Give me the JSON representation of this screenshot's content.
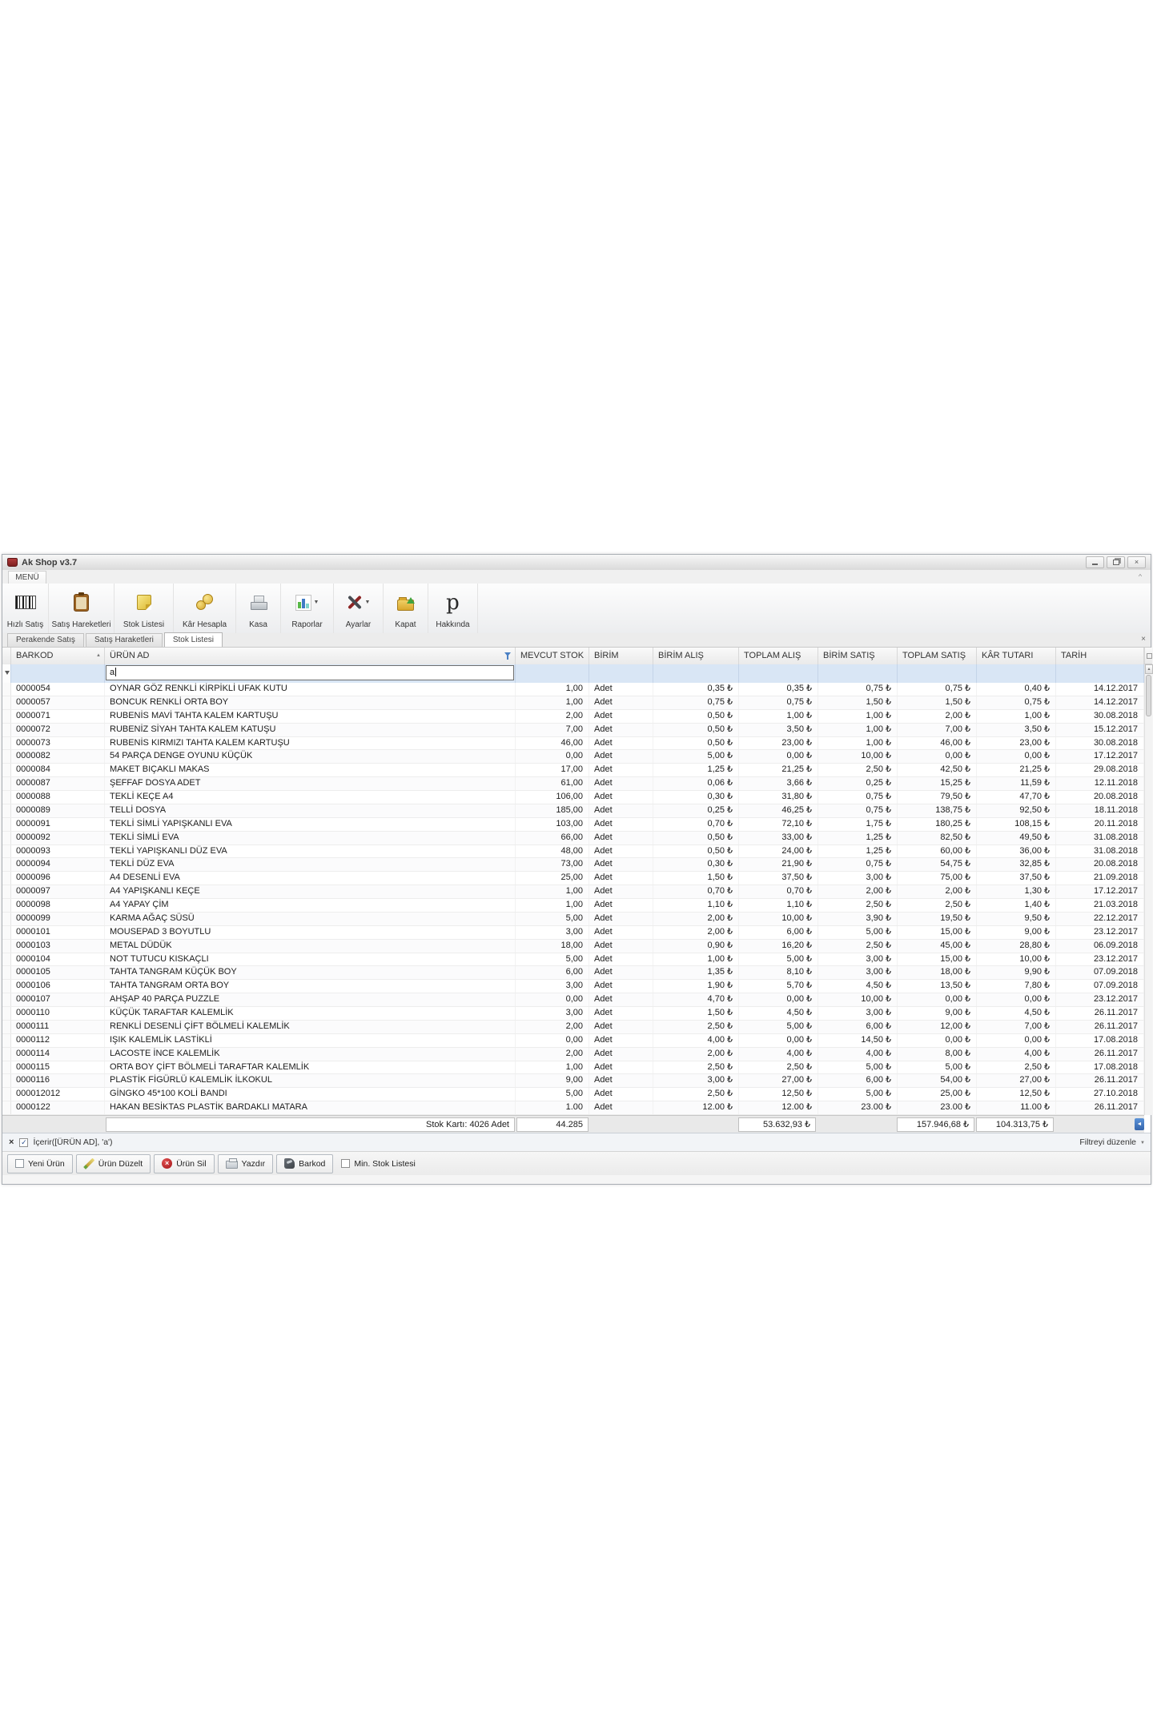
{
  "window": {
    "title": "Ak Shop v3.7"
  },
  "icons": {
    "minimize": "–",
    "restore": "❐",
    "close": "×",
    "ribbon_collapse": "^",
    "tab_close": "×",
    "sort_ascending": "▲",
    "filter_funnel": "funnel",
    "scroll_up": "▲",
    "scroll_left": "◄",
    "dropdown_arrow": "▼",
    "filter_check": "✓",
    "remove_filter": "×",
    "hakkinda_glyph": "p"
  },
  "menu": {
    "tab": "MENÜ"
  },
  "toolbar": {
    "buttons": [
      {
        "label": "Hızlı Satış",
        "icon": "barcode-icon",
        "dropdown": false
      },
      {
        "label": "Satış Hareketleri",
        "icon": "clipboard-icon",
        "dropdown": false
      },
      {
        "label": "Stok Listesi",
        "icon": "note-icon",
        "dropdown": false
      },
      {
        "label": "Kâr Hesapla",
        "icon": "coins-icon",
        "dropdown": false
      },
      {
        "label": "Kasa",
        "icon": "cash-register-icon",
        "dropdown": false
      },
      {
        "label": "Raporlar",
        "icon": "chart-icon",
        "dropdown": true
      },
      {
        "label": "Ayarlar",
        "icon": "tools-icon",
        "dropdown": true
      },
      {
        "label": "Kapat",
        "icon": "folder-up-icon",
        "dropdown": false
      },
      {
        "label": "Hakkında",
        "icon": "p-letter-icon",
        "dropdown": false
      }
    ]
  },
  "tabs": [
    {
      "label": "Perakende Satış",
      "active": false
    },
    {
      "label": "Satış Haraketleri",
      "active": false
    },
    {
      "label": "Stok Listesi",
      "active": true
    }
  ],
  "grid": {
    "columns": [
      "BARKOD",
      "ÜRÜN AD",
      "MEVCUT STOK",
      "BİRİM",
      "BİRİM ALIŞ",
      "TOPLAM ALIŞ",
      "BİRİM SATIŞ",
      "TOPLAM SATIŞ",
      "KÂR TUTARI",
      "TARİH"
    ],
    "filter_value": "a",
    "rows": [
      [
        "0000054",
        "OYNAR GÖZ RENKLİ KİRPİKLİ UFAK KUTU",
        "1,00",
        "Adet",
        "0,35 ₺",
        "0,35 ₺",
        "0,75 ₺",
        "0,75 ₺",
        "0,40 ₺",
        "14.12.2017"
      ],
      [
        "0000057",
        "BONCUK RENKLİ ORTA BOY",
        "1,00",
        "Adet",
        "0,75 ₺",
        "0,75 ₺",
        "1,50 ₺",
        "1,50 ₺",
        "0,75 ₺",
        "14.12.2017"
      ],
      [
        "0000071",
        "RUBENİS MAVİ TAHTA KALEM KARTUŞU",
        "2,00",
        "Adet",
        "0,50 ₺",
        "1,00 ₺",
        "1,00 ₺",
        "2,00 ₺",
        "1,00 ₺",
        "30.08.2018"
      ],
      [
        "0000072",
        "RUBENİZ SİYAH TAHTA KALEM KATUŞU",
        "7,00",
        "Adet",
        "0,50 ₺",
        "3,50 ₺",
        "1,00 ₺",
        "7,00 ₺",
        "3,50 ₺",
        "15.12.2017"
      ],
      [
        "0000073",
        "RUBENİS KIRMIZI TAHTA KALEM KARTUŞU",
        "46,00",
        "Adet",
        "0,50 ₺",
        "23,00 ₺",
        "1,00 ₺",
        "46,00 ₺",
        "23,00 ₺",
        "30.08.2018"
      ],
      [
        "0000082",
        "54 PARÇA DENGE OYUNU KÜÇÜK",
        "0,00",
        "Adet",
        "5,00 ₺",
        "0,00 ₺",
        "10,00 ₺",
        "0,00 ₺",
        "0,00 ₺",
        "17.12.2017"
      ],
      [
        "0000084",
        "MAKET BIÇAKLI MAKAS",
        "17,00",
        "Adet",
        "1,25 ₺",
        "21,25 ₺",
        "2,50 ₺",
        "42,50 ₺",
        "21,25 ₺",
        "29.08.2018"
      ],
      [
        "0000087",
        "ŞEFFAF DOSYA ADET",
        "61,00",
        "Adet",
        "0,06 ₺",
        "3,66 ₺",
        "0,25 ₺",
        "15,25 ₺",
        "11,59 ₺",
        "12.11.2018"
      ],
      [
        "0000088",
        "TEKLİ KEÇE A4",
        "106,00",
        "Adet",
        "0,30 ₺",
        "31,80 ₺",
        "0,75 ₺",
        "79,50 ₺",
        "47,70 ₺",
        "20.08.2018"
      ],
      [
        "0000089",
        "TELLİ DOSYA",
        "185,00",
        "Adet",
        "0,25 ₺",
        "46,25 ₺",
        "0,75 ₺",
        "138,75 ₺",
        "92,50 ₺",
        "18.11.2018"
      ],
      [
        "0000091",
        "TEKLİ SİMLİ YAPIŞKANLI EVA",
        "103,00",
        "Adet",
        "0,70 ₺",
        "72,10 ₺",
        "1,75 ₺",
        "180,25 ₺",
        "108,15 ₺",
        "20.11.2018"
      ],
      [
        "0000092",
        "TEKLİ SİMLİ EVA",
        "66,00",
        "Adet",
        "0,50 ₺",
        "33,00 ₺",
        "1,25 ₺",
        "82,50 ₺",
        "49,50 ₺",
        "31.08.2018"
      ],
      [
        "0000093",
        "TEKLİ YAPIŞKANLI DÜZ EVA",
        "48,00",
        "Adet",
        "0,50 ₺",
        "24,00 ₺",
        "1,25 ₺",
        "60,00 ₺",
        "36,00 ₺",
        "31.08.2018"
      ],
      [
        "0000094",
        "TEKLİ DÜZ EVA",
        "73,00",
        "Adet",
        "0,30 ₺",
        "21,90 ₺",
        "0,75 ₺",
        "54,75 ₺",
        "32,85 ₺",
        "20.08.2018"
      ],
      [
        "0000096",
        "A4 DESENLİ EVA",
        "25,00",
        "Adet",
        "1,50 ₺",
        "37,50 ₺",
        "3,00 ₺",
        "75,00 ₺",
        "37,50 ₺",
        "21.09.2018"
      ],
      [
        "0000097",
        "A4 YAPIŞKANLI KEÇE",
        "1,00",
        "Adet",
        "0,70 ₺",
        "0,70 ₺",
        "2,00 ₺",
        "2,00 ₺",
        "1,30 ₺",
        "17.12.2017"
      ],
      [
        "0000098",
        "A4 YAPAY ÇİM",
        "1,00",
        "Adet",
        "1,10 ₺",
        "1,10 ₺",
        "2,50 ₺",
        "2,50 ₺",
        "1,40 ₺",
        "21.03.2018"
      ],
      [
        "0000099",
        "KARMA AĞAÇ SÜSÜ",
        "5,00",
        "Adet",
        "2,00 ₺",
        "10,00 ₺",
        "3,90 ₺",
        "19,50 ₺",
        "9,50 ₺",
        "22.12.2017"
      ],
      [
        "0000101",
        "MOUSEPAD 3 BOYUTLU",
        "3,00",
        "Adet",
        "2,00 ₺",
        "6,00 ₺",
        "5,00 ₺",
        "15,00 ₺",
        "9,00 ₺",
        "23.12.2017"
      ],
      [
        "0000103",
        "METAL DÜDÜK",
        "18,00",
        "Adet",
        "0,90 ₺",
        "16,20 ₺",
        "2,50 ₺",
        "45,00 ₺",
        "28,80 ₺",
        "06.09.2018"
      ],
      [
        "0000104",
        "NOT TUTUCU KISKAÇLI",
        "5,00",
        "Adet",
        "1,00 ₺",
        "5,00 ₺",
        "3,00 ₺",
        "15,00 ₺",
        "10,00 ₺",
        "23.12.2017"
      ],
      [
        "0000105",
        "TAHTA TANGRAM KÜÇÜK BOY",
        "6,00",
        "Adet",
        "1,35 ₺",
        "8,10 ₺",
        "3,00 ₺",
        "18,00 ₺",
        "9,90 ₺",
        "07.09.2018"
      ],
      [
        "0000106",
        "TAHTA TANGRAM ORTA BOY",
        "3,00",
        "Adet",
        "1,90 ₺",
        "5,70 ₺",
        "4,50 ₺",
        "13,50 ₺",
        "7,80 ₺",
        "07.09.2018"
      ],
      [
        "0000107",
        "AHŞAP 40 PARÇA PUZZLE",
        "0,00",
        "Adet",
        "4,70 ₺",
        "0,00 ₺",
        "10,00 ₺",
        "0,00 ₺",
        "0,00 ₺",
        "23.12.2017"
      ],
      [
        "0000110",
        "KÜÇÜK TARAFTAR KALEMLİK",
        "3,00",
        "Adet",
        "1,50 ₺",
        "4,50 ₺",
        "3,00 ₺",
        "9,00 ₺",
        "4,50 ₺",
        "26.11.2017"
      ],
      [
        "0000111",
        "RENKLİ DESENLİ ÇİFT BÖLMELİ KALEMLİK",
        "2,00",
        "Adet",
        "2,50 ₺",
        "5,00 ₺",
        "6,00 ₺",
        "12,00 ₺",
        "7,00 ₺",
        "26.11.2017"
      ],
      [
        "0000112",
        "IŞIK KALEMLİK LASTİKLİ",
        "0,00",
        "Adet",
        "4,00 ₺",
        "0,00 ₺",
        "14,50 ₺",
        "0,00 ₺",
        "0,00 ₺",
        "17.08.2018"
      ],
      [
        "0000114",
        "LACOSTE İNCE KALEMLİK",
        "2,00",
        "Adet",
        "2,00 ₺",
        "4,00 ₺",
        "4,00 ₺",
        "8,00 ₺",
        "4,00 ₺",
        "26.11.2017"
      ],
      [
        "0000115",
        "ORTA BOY ÇİFT BÖLMELİ TARAFTAR KALEMLİK",
        "1,00",
        "Adet",
        "2,50 ₺",
        "2,50 ₺",
        "5,00 ₺",
        "5,00 ₺",
        "2,50 ₺",
        "17.08.2018"
      ],
      [
        "0000116",
        "PLASTİK FİGÜRLÜ KALEMLİK İLKOKUL",
        "9,00",
        "Adet",
        "3,00 ₺",
        "27,00 ₺",
        "6,00 ₺",
        "54,00 ₺",
        "27,00 ₺",
        "26.11.2017"
      ],
      [
        "000012012",
        "GİNGKO 45*100 KOLİ BANDI",
        "5,00",
        "Adet",
        "2,50 ₺",
        "12,50 ₺",
        "5,00 ₺",
        "25,00 ₺",
        "12,50 ₺",
        "27.10.2018"
      ],
      [
        "0000122",
        "HAKAN BESİKTAS PLASTİK BARDAKLI MATARA",
        "1.00",
        "Adet",
        "12.00 ₺",
        "12.00 ₺",
        "23.00 ₺",
        "23.00 ₺",
        "11.00 ₺",
        "26.11.2017"
      ]
    ],
    "summary": {
      "label": "Stok Kartı: 4026 Adet",
      "mevcut_stok": "44.285",
      "toplam_alis": "53.632,93 ₺",
      "toplam_satis": "157.946,68 ₺",
      "kar_tutari": "104.313,75 ₺"
    }
  },
  "filter_bar": {
    "remove": "×",
    "checked": true,
    "expression": "İçerir([ÜRÜN AD], 'a')",
    "edit_label": "Filtreyi düzenle"
  },
  "bottom_toolbar": {
    "buttons": [
      {
        "label": "Yeni Ürün",
        "icon": "new-item-icon"
      },
      {
        "label": "Ürün Düzelt",
        "icon": "edit-icon"
      },
      {
        "label": "Ürün Sil",
        "icon": "delete-icon"
      },
      {
        "label": "Yazdır",
        "icon": "print-icon"
      },
      {
        "label": "Barkod",
        "icon": "barkod2-icon"
      }
    ],
    "checkbox_label": "Min. Stok Listesi",
    "checkbox_checked": false
  },
  "theme": {
    "filter_row_bg": "#d9e6f5",
    "header_bg": "#efefef",
    "accent_blue": "#3f7ac5",
    "delete_red": "#c1272d"
  }
}
